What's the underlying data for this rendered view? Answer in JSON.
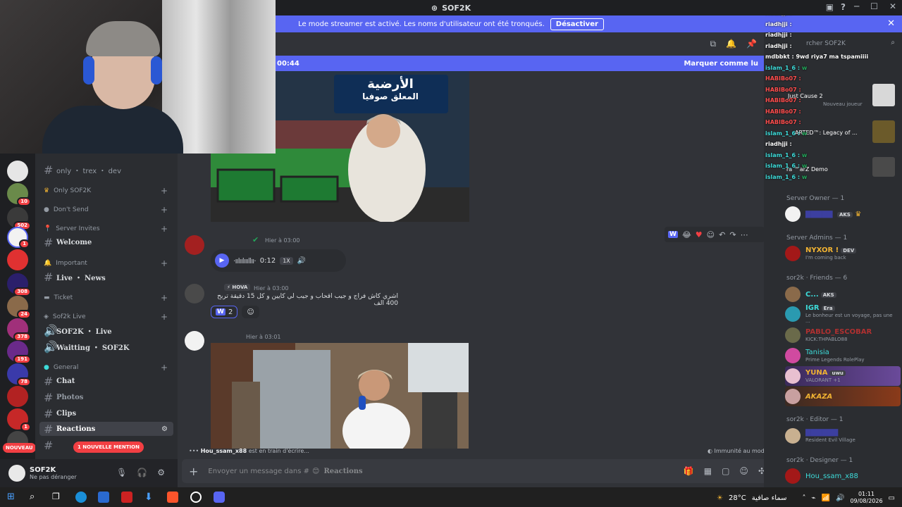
{
  "window": {
    "title": "SOF2K"
  },
  "banner": {
    "text": "Le mode streamer est activé. Les noms d'utilisateur ont été tronqués.",
    "button": "Désactiver"
  },
  "new_bar": {
    "time": "00:44",
    "mark_read": "Marquer comme lu"
  },
  "server_badges": [
    "10",
    "502",
    "1",
    "308",
    "24",
    "378",
    "191",
    "78",
    "1"
  ],
  "nouveau": "NOUVEAU",
  "channels": {
    "top_channel": "only ・ trex ・ dev",
    "cat_only": "Only SOF2K",
    "cat_dontsend": "Don't Send",
    "cat_invites": "Server Invites",
    "welcome": "Welcome",
    "cat_important": "Important",
    "live_news": "Live ・ News",
    "cat_ticket": "Ticket",
    "cat_sof2k_live": "Sof2k Live",
    "sof2k_live": "SOF2K ・ Live",
    "waitting": "Waitting ・ SOF2K",
    "cat_general": "General",
    "chat": "Chat",
    "photos": "Photos",
    "clips": "Clips",
    "reactions": "Reactions",
    "mention_pill": "1 NOUVELLE MENTION"
  },
  "user": {
    "name": "SOF2K",
    "status": "Ne pas déranger"
  },
  "image1": {
    "sign_line1": "الأرضية",
    "sign_line2": "المعلق صوفيا"
  },
  "messages": {
    "m1_time": "Hier à 03:00",
    "voice_duration": "0:12",
    "voice_speed": "1X",
    "m2_tag": "HOVA",
    "m2_time": "Hier à 03:00",
    "m2_text": "اشري كاش فراج و جيب اقحاب و جيب لي كايين و كل 15 دقيقة تربح 400 الف",
    "m2_react_count": "2",
    "m3_time": "Hier à 03:01"
  },
  "typing": {
    "user": "Hou_ssam_x88",
    "text": "est en train d'écrire..."
  },
  "slowmode": "Immunité au mode lent",
  "composer": {
    "placeholder": "Envoyer un message dans #",
    "channel": "Reactions"
  },
  "header": {
    "search": "rcher SOF2K"
  },
  "members": {
    "owner_section": "Server Owner — 1",
    "owner_tag": "AKS",
    "admins_section": "Server Admins — 1",
    "admin_name": "NYXOR !",
    "admin_tag": "DEV",
    "admin_status": "I'm coming back",
    "friends_section": "sor2k · Friends — 6",
    "f1_name": "C...",
    "f1_tag": "AKS",
    "f2_name": "IGR",
    "f2_tag": "Era",
    "f2_status": "Le bonheur est un voyage, pas une ...",
    "f3_name": "PABLO_ESCOBAR",
    "f3_status": "KICK:THPABLO88",
    "f4_name": "Tanisia",
    "f4_status": "Prime Legends RolePlay",
    "f5_name": "YUNA",
    "f5_tag": "uwu",
    "f5_status": "VALORANT +1",
    "f6_name": "AKAZA",
    "editor_section": "sor2k · Editor — 1",
    "editor_status": "Resident Evil Village",
    "designer_section": "sor2k · Designer — 1",
    "designer_name": "Hou_ssam_x88",
    "activity1": "Just Cause 2",
    "activity1_sub": "Nouveau joueur",
    "activity2": "ARTED™: Legacy of ...",
    "activity3": "ra ™arZ Demo"
  },
  "stream_chat": [
    {
      "user": "riadhjji",
      "msg": "",
      "color": "#ffffff"
    },
    {
      "user": "riadhjji",
      "msg": "",
      "color": "#ffffff"
    },
    {
      "user": "riadhjji",
      "msg": "",
      "color": "#ffffff"
    },
    {
      "user": "riadhjji",
      "msg": "",
      "color": "#ffffff"
    },
    {
      "user": "mdbbkt",
      "msg": "9wd riya7 ma tspamiiii",
      "color": "#ffffff"
    },
    {
      "user": "islam_1_6",
      "msg": "w",
      "color": "#3ddbd9"
    },
    {
      "user": "HABIBo07",
      "msg": "",
      "color": "#ff4d4d"
    },
    {
      "user": "HABIBo07",
      "msg": "",
      "color": "#ff4d4d"
    },
    {
      "user": "HABIBo07",
      "msg": "",
      "color": "#ff4d4d"
    },
    {
      "user": "HABIBo07",
      "msg": "",
      "color": "#ff4d4d"
    },
    {
      "user": "HABIBo07",
      "msg": "",
      "color": "#ff4d4d"
    },
    {
      "user": "islam_1_6",
      "msg": "w",
      "color": "#3ddbd9"
    },
    {
      "user": "riadhjji",
      "msg": "",
      "color": "#ffffff"
    },
    {
      "user": "islam_1_6",
      "msg": "w",
      "color": "#3ddbd9"
    },
    {
      "user": "islam_1_6",
      "msg": "w",
      "color": "#3ddbd9"
    },
    {
      "user": "islam_1_6",
      "msg": "w",
      "color": "#3ddbd9"
    }
  ],
  "taskbar": {
    "temp": "28°C",
    "weather": "سماء صافية",
    "time": "01:11",
    "date": "09/08/2026"
  },
  "colors": {
    "accent": "#5865f2",
    "danger": "#f23f43",
    "bg": "#313338"
  }
}
